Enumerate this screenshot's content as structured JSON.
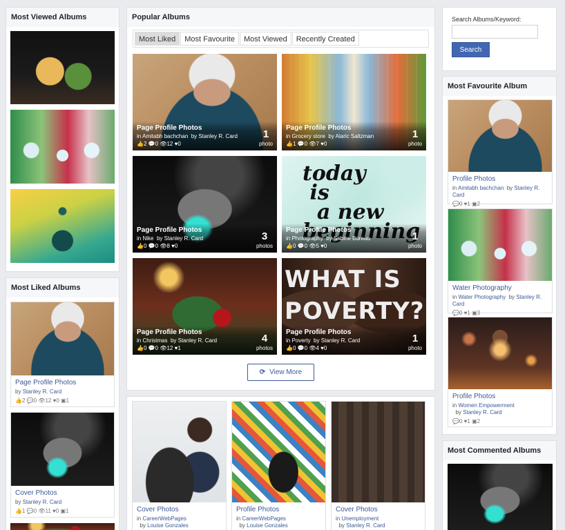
{
  "most_viewed": {
    "title": "Most Viewed Albums"
  },
  "popular": {
    "title": "Popular Albums",
    "tabs": [
      "Most Liked",
      "Most Favourite",
      "Most Viewed",
      "Recently Created"
    ],
    "active_tab": "Most Liked",
    "view_more": "View More",
    "items": [
      {
        "title": "Page Profile Photos",
        "in": "in",
        "category": "Amitabh bachchan",
        "by": "by",
        "owner": "Stanley R. Card",
        "likes": "2",
        "comments": "0",
        "views": "12",
        "favs": "0",
        "count": "1",
        "count_label": "photo"
      },
      {
        "title": "Page Profile Photos",
        "in": "in",
        "category": "Grocery store",
        "by": "by",
        "owner": "Alaric Saltzman",
        "likes": "1",
        "comments": "0",
        "views": "7",
        "favs": "0",
        "count": "1",
        "count_label": "photo"
      },
      {
        "title": "Page Profile Photos",
        "in": "in",
        "category": "Nike",
        "by": "by",
        "owner": "Stanley R. Card",
        "likes": "0",
        "comments": "0",
        "views": "8",
        "favs": "0",
        "count": "3",
        "count_label": "photos"
      },
      {
        "title": "Page Profile Photos",
        "in": "in",
        "category": "Photography",
        "by": "by",
        "owner": "Sabine Bureau",
        "likes": "0",
        "comments": "0",
        "views": "5",
        "favs": "0",
        "count": "1",
        "count_label": "photo",
        "image_text": "today\n is\n  a new\nbeginning"
      },
      {
        "title": "Page Profile Photos",
        "in": "in",
        "category": "Christmas",
        "by": "by",
        "owner": "Stanley R. Card",
        "likes": "0",
        "comments": "0",
        "views": "12",
        "favs": "1",
        "count": "4",
        "count_label": "photos"
      },
      {
        "title": "Page Profile Photos",
        "in": "in",
        "category": "Poverty",
        "by": "by",
        "owner": "Stanley R. Card",
        "likes": "0",
        "comments": "0",
        "views": "4",
        "favs": "0",
        "count": "1",
        "count_label": "photo",
        "image_text": "WHAT IS\nPOVERTY?"
      }
    ]
  },
  "bottom_albums": [
    {
      "title": "Cover Photos",
      "in": "in",
      "category": "CareerWebPages",
      "by": "by",
      "owner": "Louise Gonzales"
    },
    {
      "title": "Profile Photos",
      "in": "in",
      "category": "CareerWebPages",
      "by": "by",
      "owner": "Louise Gonzales"
    },
    {
      "title": "Cover Photos",
      "in": "in",
      "category": "Unemployment",
      "by": "by",
      "owner": "Stanley R. Card"
    }
  ],
  "most_liked": {
    "title": "Most Liked Albums",
    "items": [
      {
        "title": "Page Profile Photos",
        "by": "by",
        "owner": "Stanley R. Card",
        "likes": "2",
        "comments": "0",
        "views": "12",
        "favs": "0",
        "photos": "1"
      },
      {
        "title": "Cover Photos",
        "by": "by",
        "owner": "Stanley R. Card",
        "likes": "1",
        "comments": "0",
        "views": "11",
        "favs": "0",
        "photos": "1"
      }
    ]
  },
  "search": {
    "label": "Search Albums/Keyword:",
    "placeholder": "",
    "button": "Search"
  },
  "most_favourite": {
    "title": "Most Favourite Album",
    "items": [
      {
        "title": "Profile Photos",
        "in": "in",
        "category": "Amitabh bachchan",
        "by": "by",
        "owner": "Stanley R. Card",
        "comments": "0",
        "likes": "1",
        "photos": "2"
      },
      {
        "title": "Water Photography",
        "in": "in",
        "category": "Water Photography",
        "by": "by",
        "owner": "Stanley R. Card",
        "comments": "0",
        "likes": "1",
        "photos": "3"
      },
      {
        "title": "Profile Photos",
        "in": "in",
        "category": "Women Empowerment",
        "by": "by",
        "owner": "Stanley R. Card",
        "comments": "0",
        "likes": "1",
        "photos": "2"
      }
    ]
  },
  "most_commented": {
    "title": "Most Commented Albums"
  }
}
